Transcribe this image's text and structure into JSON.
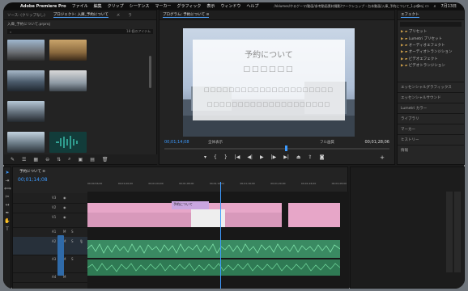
{
  "menubar": {
    "app": "Adobe Premiere Pro",
    "items": [
      "ファイル",
      "編集",
      "クリップ",
      "シーケンス",
      "マーカー",
      "グラフィック",
      "表示",
      "ウィンドウ",
      "ヘルプ"
    ],
    "path": "/Volumes/やるゲーマ/動画/参考動画素材撮影/ワークショップ・台本動画/入庫_予約について_1.prproj",
    "clock": "7月13日"
  },
  "project": {
    "tabs": [
      "ソース: (クリップなし)",
      "プロジェクト: 入庫_予約について",
      "メ",
      "ラ"
    ],
    "title": "入庫_予約について.prproj",
    "count": "18 個のアイテム"
  },
  "program": {
    "tab": "プログラム: 予約について ≡",
    "title": "予約について",
    "timecode": "00;01;14;08",
    "fit": "全体表示",
    "quality": "フル画質",
    "duration": "00;01;28;06"
  },
  "effects": {
    "tab": "エフェクト",
    "items": [
      "プリセット",
      "Lumetri プリセット",
      "オーディオエフェクト",
      "オーディオトランジション",
      "ビデオエフェクト",
      "ビデオトランジション"
    ],
    "sections": [
      "エッセンシャルグラフィックス",
      "エッセンシャルサウンド",
      "Lumetri カラー",
      "ライブラリ",
      "マーカー",
      "ヒストリー",
      "情報"
    ]
  },
  "timeline": {
    "tab": "予約について ≡",
    "timecode": "00;01;14;08",
    "ruler": [
      "00;00;56;00",
      "00;01;00;00",
      "00;01;04;00",
      "00;01;08;00",
      "00;01;12;00",
      "00;01;16;00",
      "00;01;20;00",
      "00;01;24;00",
      "00;01;28;00"
    ],
    "clip_label": "予約について"
  },
  "colors": {
    "accent": "#3d9bff",
    "video_clip": "#e7a6c8",
    "audio_clip": "#3a8a62"
  }
}
